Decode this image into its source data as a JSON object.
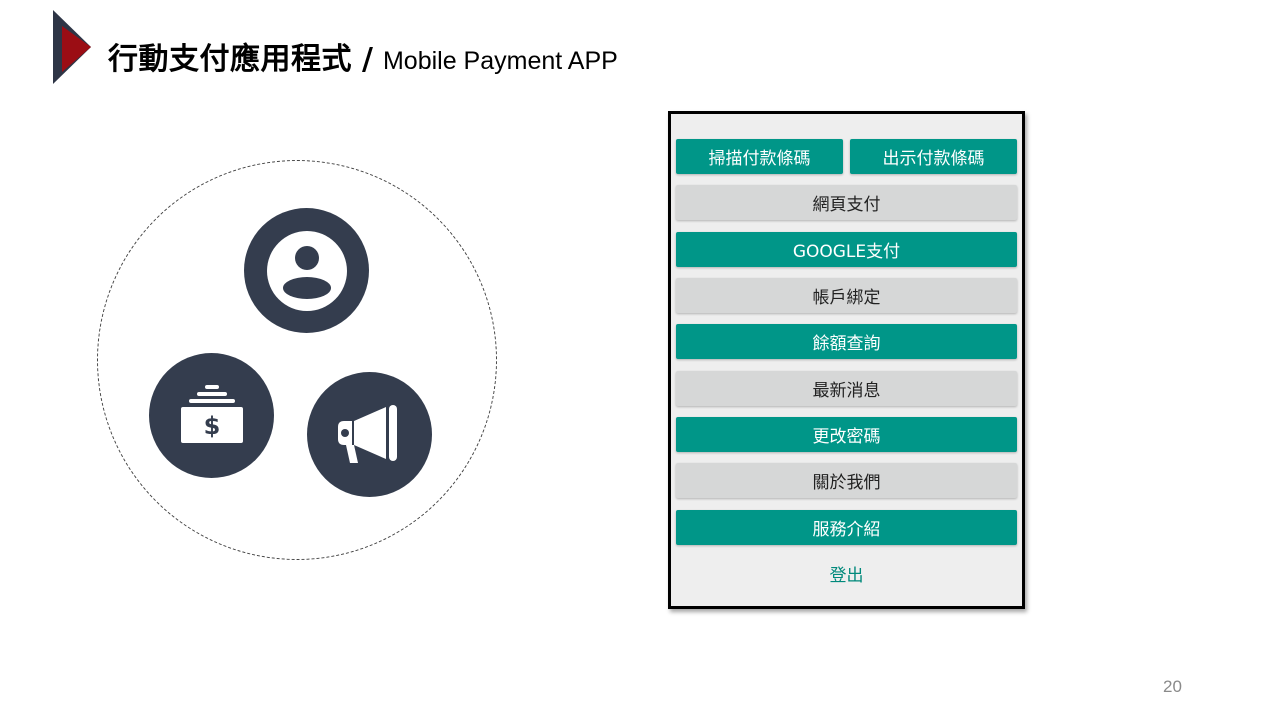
{
  "slide": {
    "title_zh": "行動支付應用程式",
    "title_sep": "/",
    "title_en": "Mobile Payment APP",
    "page_number": "20"
  },
  "icons": [
    "user-icon",
    "money-stack-icon",
    "megaphone-icon"
  ],
  "phone": {
    "top_buttons": [
      {
        "label": "掃描付款條碼",
        "style": "teal"
      },
      {
        "label": "出示付款條碼",
        "style": "teal"
      }
    ],
    "buttons": [
      {
        "label": "網頁支付",
        "style": "grey"
      },
      {
        "label": "GOOGLE支付",
        "style": "teal"
      },
      {
        "label": "帳戶綁定",
        "style": "grey"
      },
      {
        "label": "餘額查詢",
        "style": "teal"
      },
      {
        "label": "最新消息",
        "style": "grey"
      },
      {
        "label": "更改密碼",
        "style": "teal"
      },
      {
        "label": "關於我們",
        "style": "grey"
      },
      {
        "label": "服務介紹",
        "style": "teal"
      }
    ],
    "logout_label": "登出"
  },
  "colors": {
    "accent_teal": "#009688",
    "button_grey": "#d6d7d7",
    "icon_navy": "#343d4e",
    "logo_red": "#9b0d14",
    "logo_navy": "#2e3546"
  }
}
